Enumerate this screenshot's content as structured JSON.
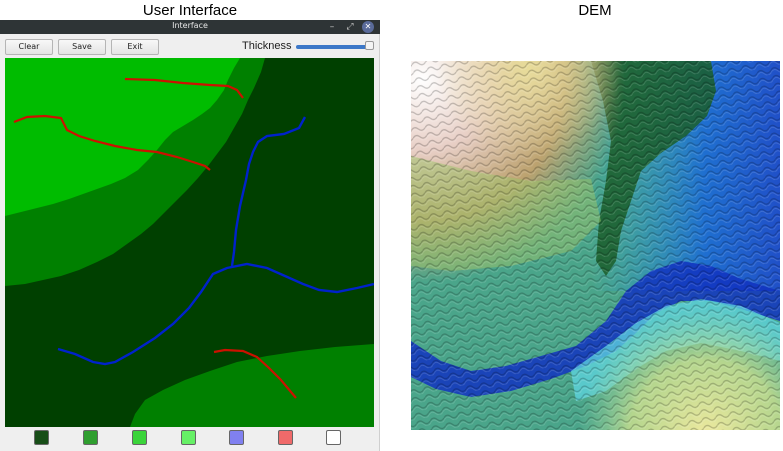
{
  "figure": {
    "left_title": "User Interface",
    "right_title": "DEM"
  },
  "window": {
    "title": "Interface"
  },
  "toolbar": {
    "clear_label": "Clear",
    "save_label": "Save",
    "exit_label": "Exit",
    "thickness_label": "Thickness",
    "thickness_value": 1.0
  },
  "palette": [
    {
      "name": "dark-green",
      "color": "#174d17"
    },
    {
      "name": "medium-green",
      "color": "#2f9e2f"
    },
    {
      "name": "green",
      "color": "#3ad43a"
    },
    {
      "name": "light-green",
      "color": "#66f066"
    },
    {
      "name": "blue",
      "color": "#8080f0"
    },
    {
      "name": "red",
      "color": "#f06a6a"
    },
    {
      "name": "white",
      "color": "#ffffff"
    }
  ],
  "canvas_colors": {
    "level1": "#00bc00",
    "level2": "#008000",
    "level3": "#004000",
    "ridge": "#cc1100",
    "river": "#0022cc"
  }
}
